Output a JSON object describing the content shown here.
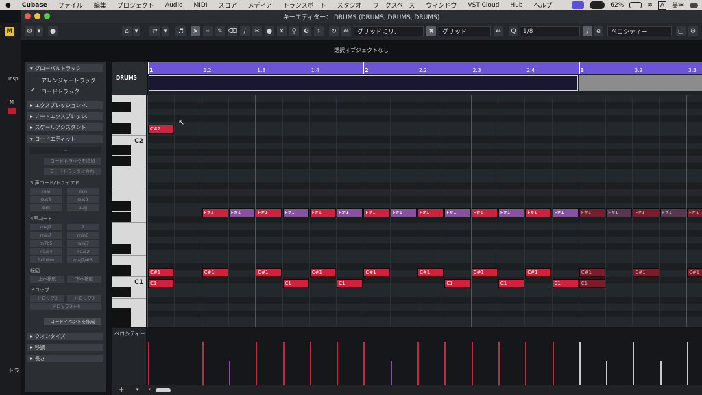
{
  "menubar": {
    "apple": "",
    "app": "Cubase",
    "items": [
      "ファイル",
      "編集",
      "プロジェクト",
      "Audio",
      "MIDI",
      "スコア",
      "メディア",
      "トランスポート",
      "スタジオ",
      "ワークスペース",
      "ウィンドウ",
      "VST Cloud",
      "Hub",
      "ヘルプ"
    ],
    "battery": "62%",
    "input": "A",
    "lang": "英字"
  },
  "window": {
    "title": "キーエディター： DRUMS (DRUMS, DRUMS, DRUMS)"
  },
  "toolbar": {
    "snap_mode": "グリッドにリ.",
    "grid_type": "グリッド",
    "quantize": "1/8",
    "velocity_label": "ベロシティー"
  },
  "info_line": "選択オブジェクトなし",
  "left_panel": {
    "insp": "Insp",
    "m": "M",
    "tra": "トラ"
  },
  "inspector": {
    "global_track": "グローバルトラック",
    "arranger_track": "アレンジャートラック",
    "chord_track": "コードトラック",
    "expression_map": "エクスプレッションマ.",
    "note_expression": "ノートエクスプレッシ.",
    "scale_assistant": "スケールアシスタント",
    "chord_edit": "コードエディット",
    "chord_display": "--",
    "add_chord_track": "コードトラックを追加",
    "fit_chord_track": "コードトラックに合わ.",
    "triad_title": "3 声コード/トライアド",
    "triad": [
      "maj",
      "min",
      "sus4",
      "sus2",
      "dim",
      "aug"
    ],
    "four_title": "4声コード",
    "four": [
      "maj7",
      "7",
      "min7",
      "min6",
      "m7b5",
      "minj7",
      "7sus4",
      "7sus2",
      "full dim",
      "maj7/#5"
    ],
    "inversion_title": "転回",
    "inversion": [
      "上へ移動",
      "下へ移動"
    ],
    "drop_title": "ドロップ",
    "drop": [
      "ドロップ2",
      "ドロップ3",
      "ドロップ2＋4"
    ],
    "create_event": "コードイベントを作成",
    "quantize": "クオンタイズ",
    "transpose": "移調",
    "length": "長さ"
  },
  "key_editor": {
    "track_name": "DRUMS",
    "velocity_lane": "ベロシティー",
    "key_c2": "C2",
    "key_c1": "C1"
  },
  "ruler": {
    "labels": [
      "1",
      "1.2",
      "1.3",
      "1.4",
      "2",
      "2.2",
      "2.3",
      "2.4",
      "3",
      "3.2",
      "3.3"
    ]
  },
  "colors": {
    "ruler": "#6b54d6",
    "note_red": "#d0213f",
    "note_purple": "#8a4fa3",
    "note_red_dim": "#7a1c2c",
    "note_purple_dim": "#5a3550"
  },
  "notes": [
    {
      "pitch": "C#2",
      "beat": 0,
      "len": 1,
      "vel": "hi"
    },
    {
      "pitch": "F#1",
      "beat": 2,
      "len": 1,
      "vel": "hi"
    },
    {
      "pitch": "F#1",
      "beat": 3,
      "len": 1,
      "vel": "lo"
    },
    {
      "pitch": "F#1",
      "beat": 4,
      "len": 1,
      "vel": "hi"
    },
    {
      "pitch": "F#1",
      "beat": 5,
      "len": 1,
      "vel": "lo"
    },
    {
      "pitch": "F#1",
      "beat": 6,
      "len": 1,
      "vel": "hi"
    },
    {
      "pitch": "F#1",
      "beat": 7,
      "len": 1,
      "vel": "lo"
    },
    {
      "pitch": "F#1",
      "beat": 8,
      "len": 1,
      "vel": "hi"
    },
    {
      "pitch": "F#1",
      "beat": 9,
      "len": 1,
      "vel": "lo"
    },
    {
      "pitch": "F#1",
      "beat": 10,
      "len": 1,
      "vel": "hi"
    },
    {
      "pitch": "F#1",
      "beat": 11,
      "len": 1,
      "vel": "lo"
    },
    {
      "pitch": "F#1",
      "beat": 12,
      "len": 1,
      "vel": "hi"
    },
    {
      "pitch": "F#1",
      "beat": 13,
      "len": 1,
      "vel": "lo"
    },
    {
      "pitch": "F#1",
      "beat": 14,
      "len": 1,
      "vel": "hi"
    },
    {
      "pitch": "F#1",
      "beat": 15,
      "len": 1,
      "vel": "lo"
    },
    {
      "pitch": "F#1",
      "beat": 16,
      "len": 1,
      "vel": "dimhi"
    },
    {
      "pitch": "F#1",
      "beat": 17,
      "len": 1,
      "vel": "dimlo"
    },
    {
      "pitch": "F#1",
      "beat": 18,
      "len": 1,
      "vel": "dimhi"
    },
    {
      "pitch": "F#1",
      "beat": 19,
      "len": 1,
      "vel": "dimlo"
    },
    {
      "pitch": "F#1",
      "beat": 20,
      "len": 1,
      "vel": "dimhi"
    },
    {
      "pitch": "C#1",
      "beat": 0,
      "len": 1,
      "vel": "hi"
    },
    {
      "pitch": "C#1",
      "beat": 2,
      "len": 1,
      "vel": "hi"
    },
    {
      "pitch": "C#1",
      "beat": 4,
      "len": 1,
      "vel": "hi"
    },
    {
      "pitch": "C#1",
      "beat": 6,
      "len": 1,
      "vel": "hi"
    },
    {
      "pitch": "C#1",
      "beat": 8,
      "len": 1,
      "vel": "hi"
    },
    {
      "pitch": "C#1",
      "beat": 10,
      "len": 1,
      "vel": "hi"
    },
    {
      "pitch": "C#1",
      "beat": 12,
      "len": 1,
      "vel": "hi"
    },
    {
      "pitch": "C#1",
      "beat": 14,
      "len": 1,
      "vel": "hi"
    },
    {
      "pitch": "C#1",
      "beat": 16,
      "len": 1,
      "vel": "dimhi"
    },
    {
      "pitch": "C#1",
      "beat": 18,
      "len": 1,
      "vel": "dimhi"
    },
    {
      "pitch": "C#1",
      "beat": 20,
      "len": 1,
      "vel": "dimhi"
    },
    {
      "pitch": "C1",
      "beat": 0,
      "len": 1,
      "vel": "hi"
    },
    {
      "pitch": "C1",
      "beat": 5,
      "len": 1,
      "vel": "hi"
    },
    {
      "pitch": "C1",
      "beat": 7,
      "len": 1,
      "vel": "hi"
    },
    {
      "pitch": "C1",
      "beat": 11,
      "len": 1,
      "vel": "hi"
    },
    {
      "pitch": "C1",
      "beat": 13,
      "len": 1,
      "vel": "hi"
    },
    {
      "pitch": "C1",
      "beat": 15,
      "len": 1,
      "vel": "hi"
    },
    {
      "pitch": "C1",
      "beat": 16,
      "len": 1,
      "vel": "dimhi"
    }
  ]
}
